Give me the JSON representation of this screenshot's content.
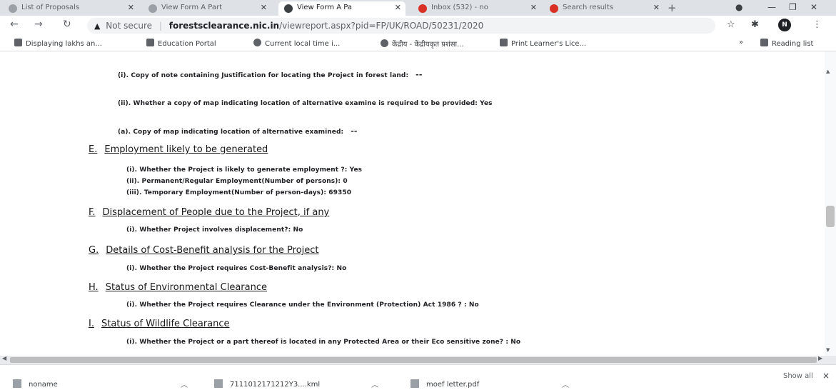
{
  "browser": {
    "tabs": [
      {
        "label": "List of Proposals",
        "active": false
      },
      {
        "label": "View Form A Part",
        "active": false
      },
      {
        "label": "View Form A Pa",
        "active": true
      },
      {
        "label": "Inbox (532) - no",
        "active": false
      },
      {
        "label": "Search results",
        "active": false
      }
    ],
    "new_tab": "+",
    "address": {
      "security_label": "Not secure",
      "host": "forestsclearance.nic.in",
      "path": "/viewreport.aspx?pid=FP/UK/ROAD/50231/2020"
    },
    "profile_initials": "N",
    "bookmarks": [
      "Displaying lakhs an...",
      "Education Portal",
      "Current local time i...",
      "केंद्रीय - केंद्रीयकृत प्रशंसा...",
      "Print Learner's Lice..."
    ],
    "reading_list": "Reading list",
    "more_bookmarks": "»"
  },
  "page": {
    "lines": [
      {
        "text": "(i). Copy of note containing Justification for locating the Project in forest land:",
        "dash": "--"
      },
      {
        "text": "(ii). Whether a copy of map indicating location of alternative examine is required to be provided: Yes",
        "dash": ""
      },
      {
        "text": "(a). Copy of map indicating location of alternative examined:",
        "dash": "--"
      }
    ],
    "sections": [
      {
        "letter": "E.",
        "title": "Employment likely to be generated",
        "items": [
          "(i). Whether the Project is likely to generate employment ?: Yes",
          "(ii). Permanent/Regular Employment(Number of persons): 0",
          "(iii). Temporary Employment(Number of person-days): 69350"
        ]
      },
      {
        "letter": "F.",
        "title": "Displacement of People due to the Project, if any",
        "items": [
          "(i). Whether Project involves displacement?: No"
        ]
      },
      {
        "letter": "G.",
        "title": "Details of Cost-Benefit analysis for the Project",
        "items": [
          "(i). Whether the Project requires Cost-Benefit analysis?: No"
        ]
      },
      {
        "letter": "H.",
        "title": "Status of Environmental Clearance",
        "items": [
          "(i). Whether the Project requires Clearance under the Environment (Protection) Act 1986 ? : No"
        ]
      },
      {
        "letter": "I.",
        "title": "Status of Wildlife Clearance",
        "items": [
          "(i). Whether the Project or a part thereof is located in any Protected Area or their Eco sensitive zone? : No"
        ]
      }
    ]
  },
  "downloads": {
    "items": [
      "noname",
      "7111012171212Y3....kml",
      "moef letter.pdf"
    ],
    "show_all": "Show all",
    "close": "×"
  }
}
